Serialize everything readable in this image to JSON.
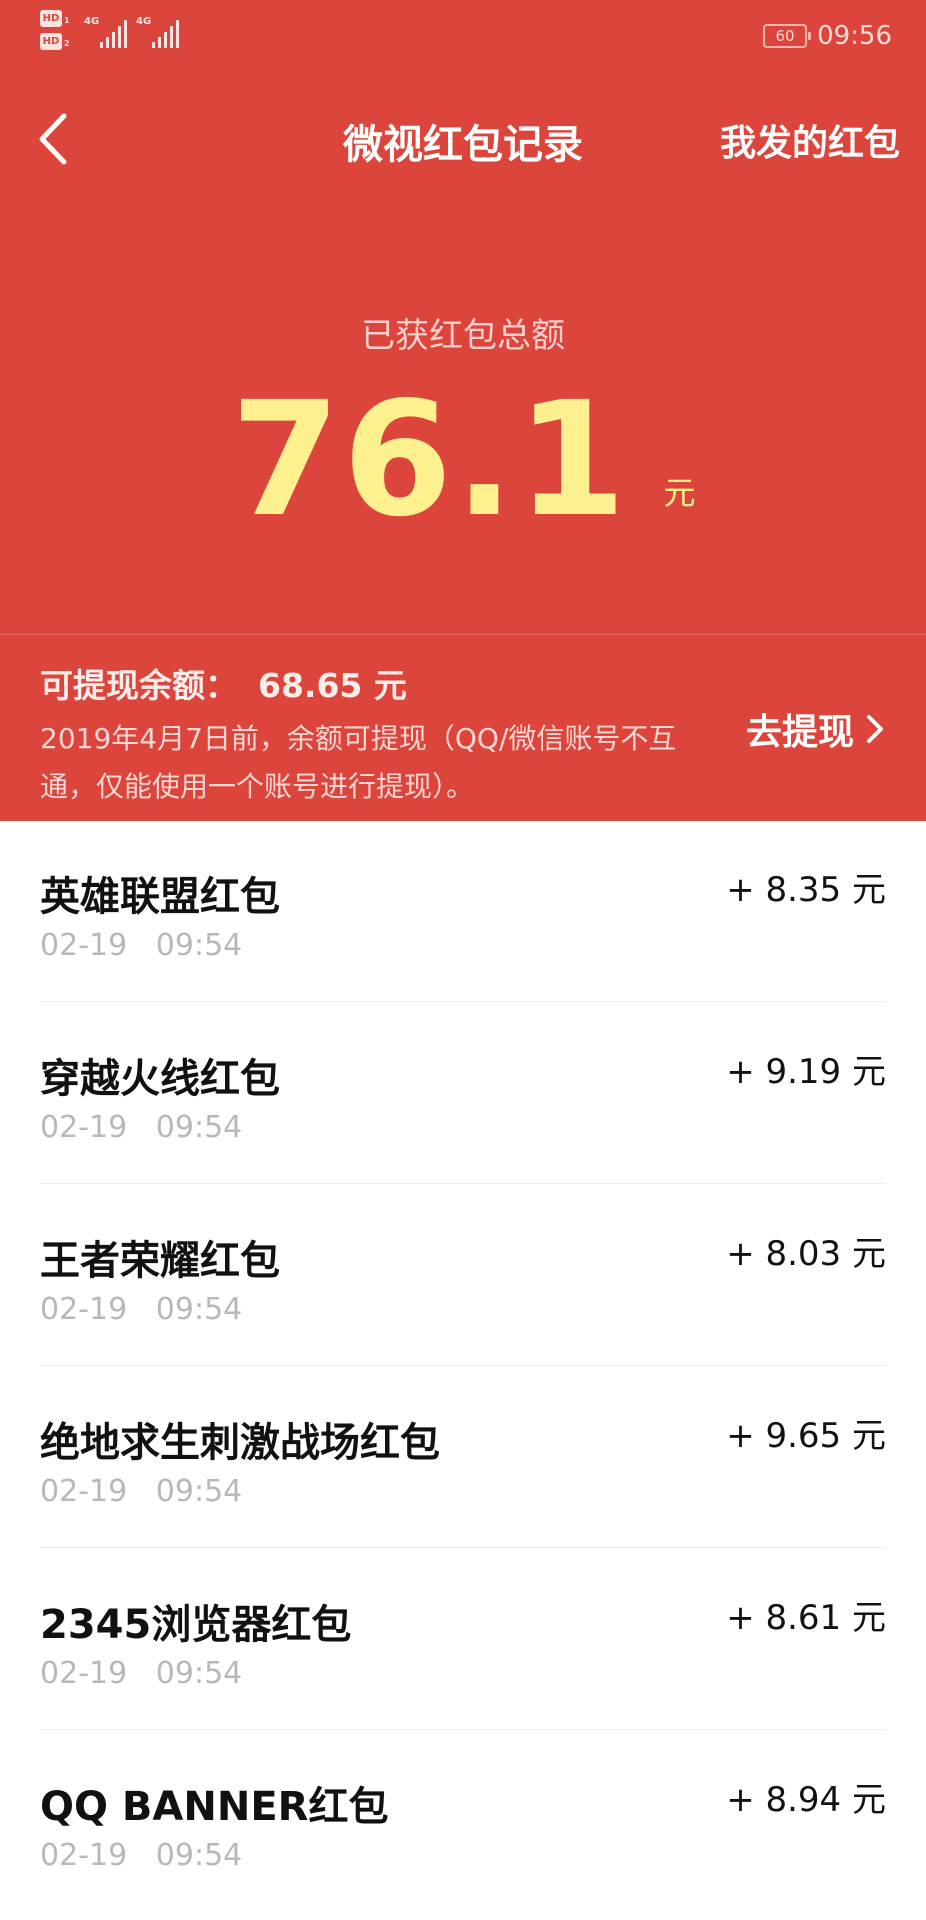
{
  "status_bar": {
    "time": "09:56",
    "battery": "60",
    "network_1": "4G",
    "network_2": "4G",
    "hd_1": "HD",
    "hd_2": "HD"
  },
  "nav": {
    "title": "微视红包记录",
    "right_label": "我发的红包",
    "back_icon": "chevron-left-icon"
  },
  "summary": {
    "label": "已获红包总额",
    "amount": "76.1",
    "unit": "元"
  },
  "withdraw": {
    "label": "可提现余额：",
    "amount": "68.65 元",
    "note": "2019年4月7日前，余额可提现（QQ/微信账号不互通，仅能使用一个账号进行提现）。",
    "button_label": "去提现",
    "button_icon": "chevron-right-icon"
  },
  "records": [
    {
      "title": "英雄联盟红包",
      "date": "02-19",
      "time": "09:54",
      "amount": "+ 8.35 元"
    },
    {
      "title": "穿越火线红包",
      "date": "02-19",
      "time": "09:54",
      "amount": "+ 9.19 元"
    },
    {
      "title": "王者荣耀红包",
      "date": "02-19",
      "time": "09:54",
      "amount": "+ 8.03 元"
    },
    {
      "title": "绝地求生刺激战场红包",
      "date": "02-19",
      "time": "09:54",
      "amount": "+ 9.65 元"
    },
    {
      "title": "2345浏览器红包",
      "date": "02-19",
      "time": "09:54",
      "amount": "+ 8.61 元"
    },
    {
      "title": "QQ BANNER红包",
      "date": "02-19",
      "time": "09:54",
      "amount": "+ 8.94 元"
    }
  ],
  "colors": {
    "header_bg": "#dc453b",
    "amount_yellow": "#fdf08f",
    "date_gray": "#b8b8b8"
  }
}
